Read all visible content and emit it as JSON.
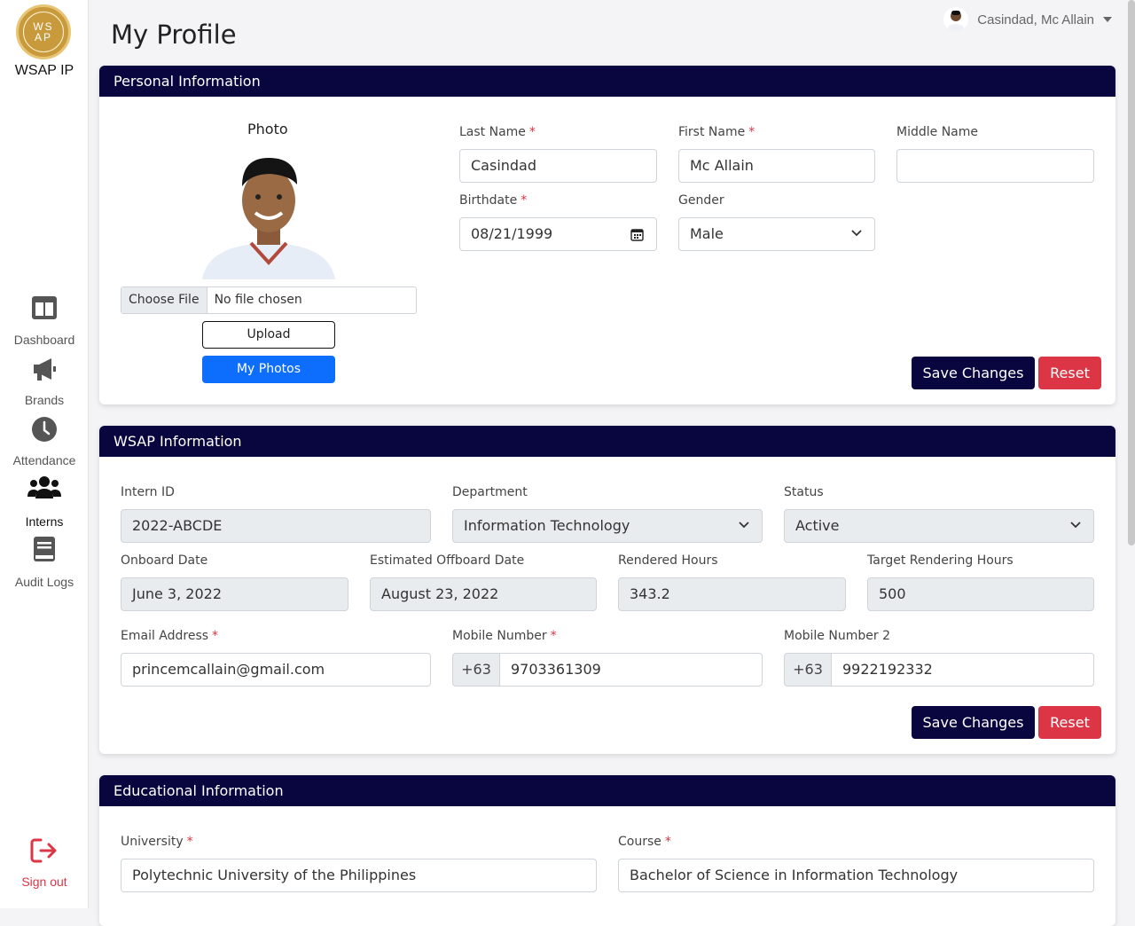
{
  "sidebar": {
    "logo_text": "WSAP IP",
    "logo_badge": "WS AP",
    "items": [
      {
        "label": "Dashboard",
        "icon": "dashboard-icon"
      },
      {
        "label": "Brands",
        "icon": "megaphone-icon"
      },
      {
        "label": "Attendance",
        "icon": "clock-icon"
      },
      {
        "label": "Interns",
        "icon": "users-icon"
      },
      {
        "label": "Audit Logs",
        "icon": "book-icon"
      }
    ],
    "signout": {
      "label": "Sign out",
      "icon": "sign-out-icon"
    }
  },
  "header": {
    "title": "My Profile",
    "user_name": "Casindad, Mc Allain"
  },
  "personal": {
    "title": "Personal Information",
    "photo_label": "Photo",
    "choose_file": "Choose File",
    "no_file": "No file chosen",
    "upload": "Upload",
    "my_photos": "My Photos",
    "last_name_label": "Last Name",
    "last_name": "Casindad",
    "first_name_label": "First Name",
    "first_name": "Mc Allain",
    "middle_name_label": "Middle Name",
    "middle_name": "",
    "birthdate_label": "Birthdate",
    "birthdate": "08/21/1999",
    "gender_label": "Gender",
    "gender": "Male",
    "save": "Save Changes",
    "reset": "Reset"
  },
  "wsap": {
    "title": "WSAP Information",
    "intern_id_label": "Intern ID",
    "intern_id": "2022-ABCDE",
    "department_label": "Department",
    "department": "Information Technology",
    "status_label": "Status",
    "status": "Active",
    "onboard_label": "Onboard Date",
    "onboard": "June 3, 2022",
    "offboard_label": "Estimated Offboard Date",
    "offboard": "August 23, 2022",
    "rendered_label": "Rendered Hours",
    "rendered": "343.2",
    "target_label": "Target Rendering Hours",
    "target": "500",
    "email_label": "Email Address",
    "email": "princemcallain@gmail.com",
    "mobile_label": "Mobile Number",
    "mobile_prefix": "+63",
    "mobile": "9703361309",
    "mobile2_label": "Mobile Number 2",
    "mobile2_prefix": "+63",
    "mobile2": "9922192332",
    "save": "Save Changes",
    "reset": "Reset"
  },
  "education": {
    "title": "Educational Information",
    "university_label": "University",
    "university": "Polytechnic University of the Philippines",
    "course_label": "Course",
    "course": "Bachelor of Science in Information Technology"
  },
  "colors": {
    "primary": "#08053f",
    "danger": "#dc3545",
    "blue": "#0d6efd",
    "gold": "#c89a3c"
  }
}
